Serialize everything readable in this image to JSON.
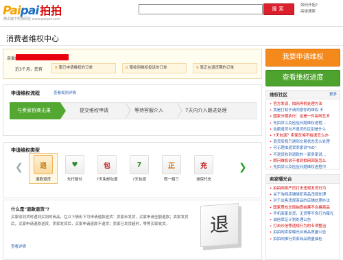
{
  "header": {
    "logo_text_1": "Pai",
    "logo_text_2": "pai",
    "logo_cn": "拍拍",
    "logo_sub": "腾讯旗下购物网站 www.paipai.com",
    "search_placeholder": "",
    "search_button": "搜索",
    "top_links": [
      "如何开始?",
      "高级搜索"
    ]
  },
  "page_title": "消费者维权中心",
  "user": {
    "greeting": "亲爱的",
    "stats_label": "近3个月，您有",
    "stats": [
      {
        "count": "0",
        "label": "笔已申请维权的订单"
      },
      {
        "count": "0",
        "label": "笔收到维权投诉的订单"
      },
      {
        "count": "9",
        "label": "笔正在退货期的订单"
      }
    ]
  },
  "actions": {
    "apply": "我要申请维权",
    "progress": "查看维权进度"
  },
  "process": {
    "title": "申请维权流程",
    "rules_link": "查看规则详情",
    "steps": [
      "与卖家协商无果",
      "提交维权申请",
      "等待客服介入",
      "7天内介入跟进处理"
    ]
  },
  "types": {
    "title": "申请维权类型",
    "items": [
      {
        "label": "退款退货",
        "glyph": "退",
        "color": "#c07a1a"
      },
      {
        "label": "先行赔付",
        "glyph": "♥",
        "color": "#2e8b2e"
      },
      {
        "label": "7天免邮包退",
        "glyph": "包",
        "color": "#c01c1c"
      },
      {
        "label": "7天包退",
        "glyph": "7",
        "color": "#2e8b2e"
      },
      {
        "label": "假一赔三",
        "glyph": "正",
        "color": "#d46a00"
      },
      {
        "label": "诚保代充",
        "glyph": "充",
        "color": "#c01c1c"
      }
    ]
  },
  "info": {
    "title": "什么是\"退款退货\"?",
    "text": "买家收到货时遇到买到的商品，在以下情形下可申请退款退货：卖家未发货，买家申请全额退款；卖家发货后，买家申请退款退货，卖家发货后，买家申请退款不退货；卖家已发货超时，等等买家收货。",
    "link": "查看详情",
    "cube_glyph": "退"
  },
  "rights_community": {
    "title": "维权社区",
    "more": "更多",
    "items": [
      {
        "text": "官方发现，拍网停机处理方法",
        "style": "red"
      },
      {
        "text": "我是打蚊子请同意你的维权 不",
        "style": "blue"
      },
      {
        "text": "国家分期执行：这是一件拍网艺术",
        "style": "red"
      },
      {
        "text": "先拍货以及检验问题维权进程...",
        "style": "blue"
      },
      {
        "text": "全额退货与不退货的区别是什么",
        "style": "blue"
      },
      {
        "text": "7天包退？卖家反悔不给退怎么办",
        "style": "red"
      },
      {
        "text": "退货后我只遇到交易状态怎么处理",
        "style": "blue"
      },
      {
        "text": "何无理由退货卖家说\"NO\"",
        "style": "blue"
      },
      {
        "text": "不退货收到退款的一家卖家说...",
        "style": "blue"
      },
      {
        "text": "顾问维权说不收到拍网回复怎么",
        "style": "red"
      },
      {
        "text": "先拍货以及检验问题维权进程中",
        "style": "blue"
      }
    ]
  },
  "exposure": {
    "title": "卖家曝光台",
    "items": [
      {
        "text": "拍拍网将严厉打击违规发货行为",
        "style": "red"
      },
      {
        "text": "关于淘网店铺侵犯商品违规处理",
        "style": "blue"
      },
      {
        "text": "对于出售违规商品的店铺处理办法",
        "style": "blue"
      },
      {
        "text": "国家质检总局抽查结果不合格商品",
        "style": "red"
      },
      {
        "text": "手机商家发货，无货等不良行为曝光",
        "style": "blue"
      },
      {
        "text": "诚信保证计划处理公告",
        "style": "blue"
      },
      {
        "text": "打击炒信等违规行为的专项整治",
        "style": "red"
      },
      {
        "text": "拍拍网卖家曝光台商品质量公告",
        "style": "blue"
      },
      {
        "text": "拍拍网推行卖家商品质量抽检",
        "style": "blue"
      }
    ]
  }
}
